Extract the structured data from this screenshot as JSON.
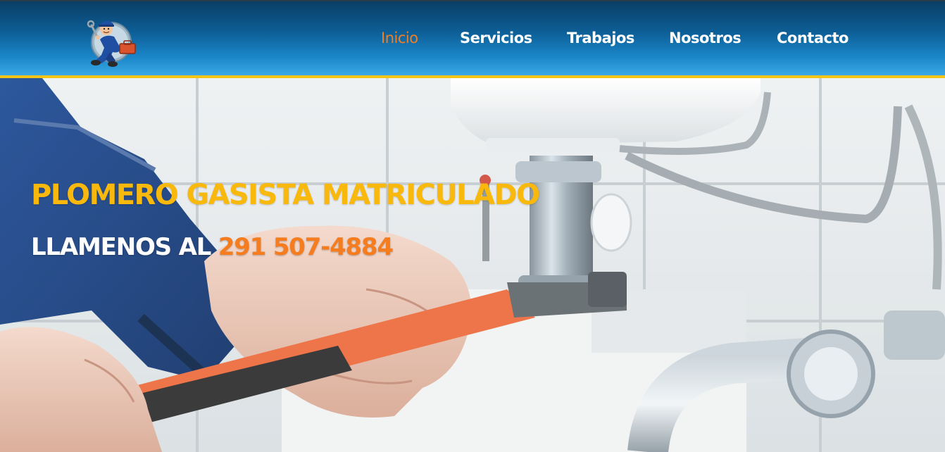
{
  "header": {
    "logo_icon": "plumber-mascot-icon",
    "nav": [
      {
        "label": "Inicio",
        "active": true
      },
      {
        "label": "Servicios",
        "active": false
      },
      {
        "label": "Trabajos",
        "active": false
      },
      {
        "label": "Nosotros",
        "active": false
      },
      {
        "label": "Contacto",
        "active": false
      }
    ]
  },
  "hero": {
    "title": "PLOMERO GASISTA MATRICULADO",
    "phone_label": "LLAMENOS AL ",
    "phone_number": "291 507-4884",
    "background_description_icon": "wrench-on-sink-pipe-image"
  },
  "colors": {
    "nav_active": "#f07f24",
    "nav_text": "#ffffff",
    "accent_stripe": "#f2c418",
    "title": "#f9b80c",
    "phone_number": "#f57c1f"
  }
}
